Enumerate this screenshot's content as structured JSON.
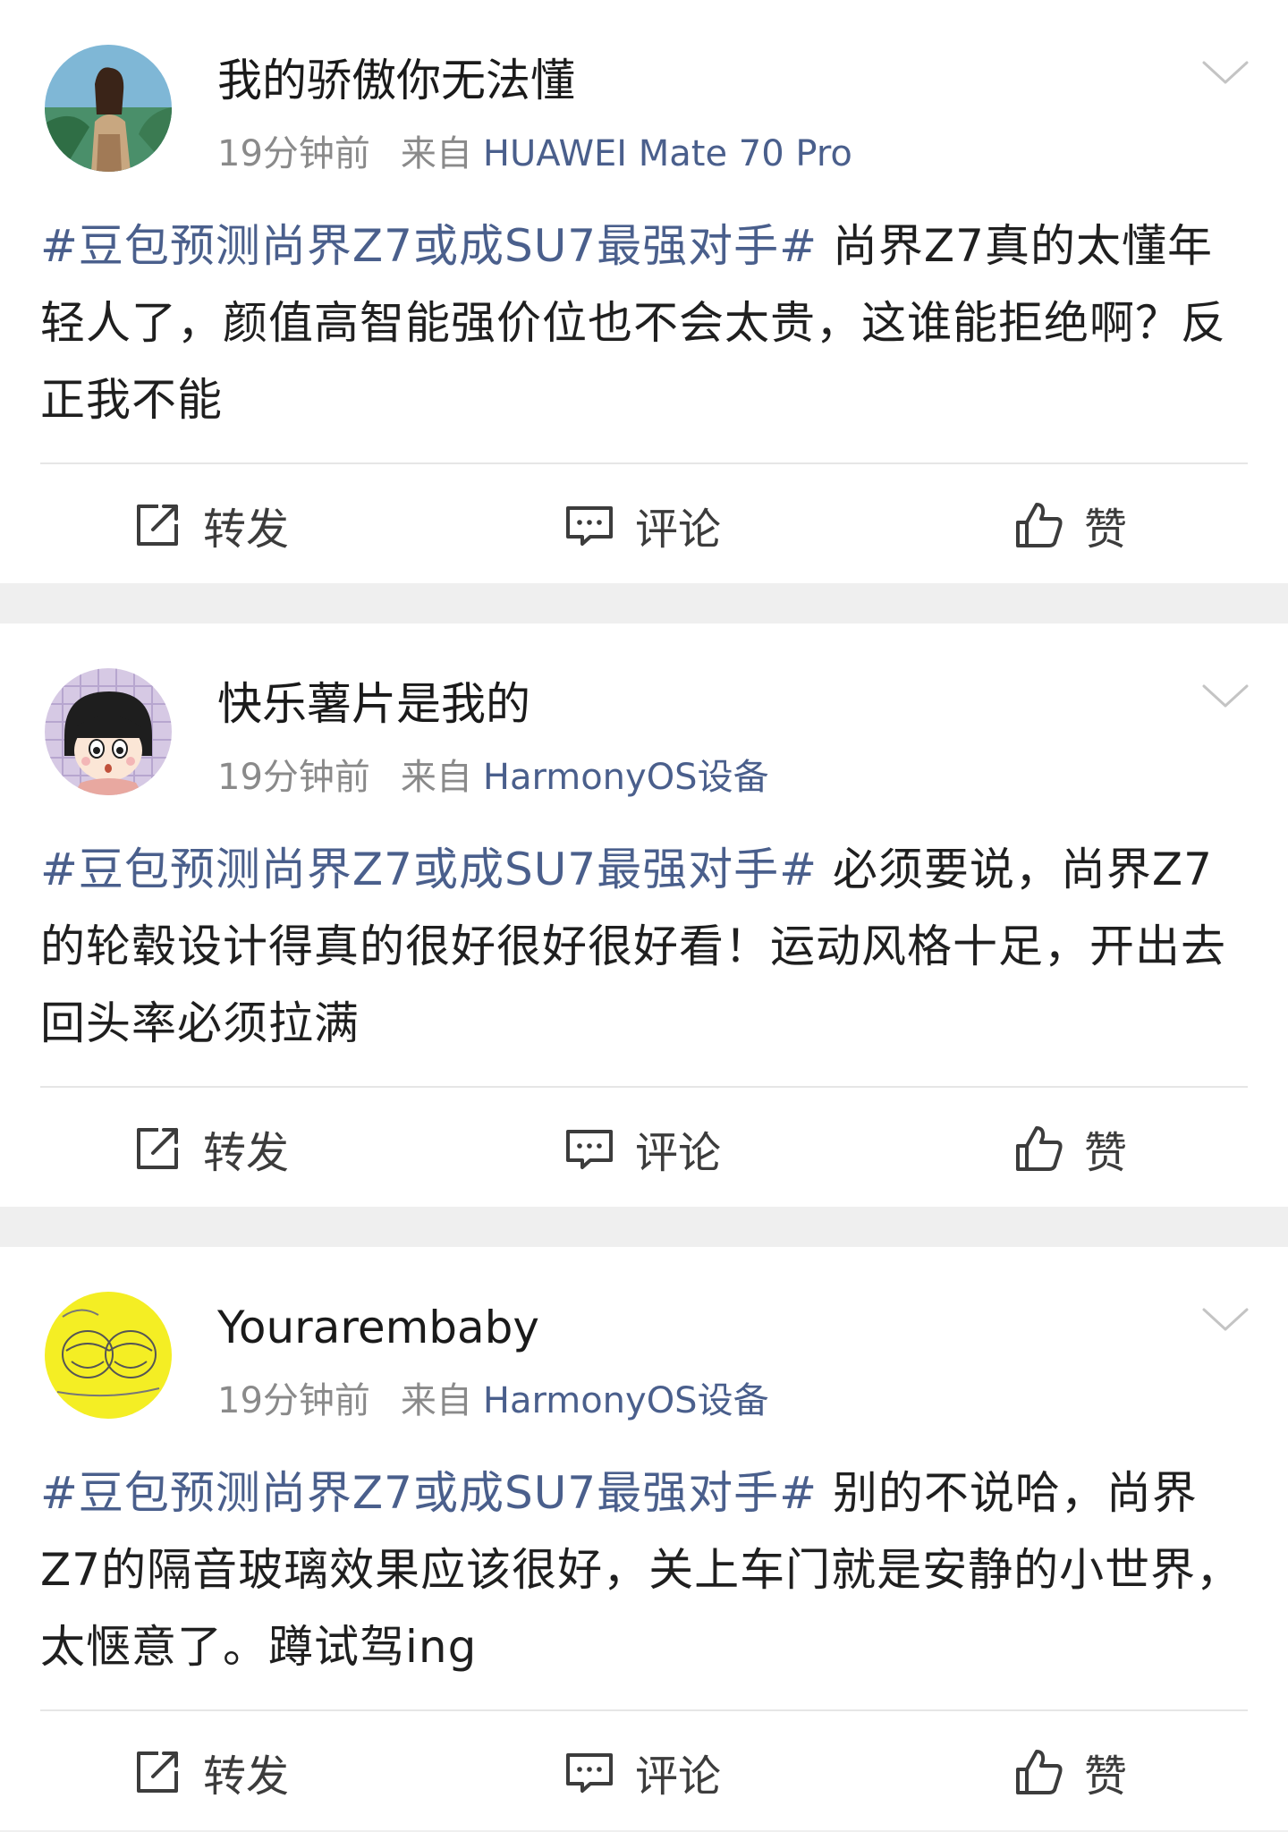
{
  "posts": [
    {
      "username": "我的骄傲你无法懂",
      "time": "19分钟前",
      "from_label": "来自",
      "device": "HUAWEI Mate 70 Pro",
      "hashtag": "#豆包预测尚界Z7或成SU7最强对手#",
      "text": " 尚界Z7真的太懂年轻人了，颜值高智能强价位也不会太贵，这谁能拒绝啊？反正我不能",
      "actions": {
        "repost": "转发",
        "comment": "评论",
        "like": "赞"
      }
    },
    {
      "username": "快乐薯片是我的",
      "time": "19分钟前",
      "from_label": "来自",
      "device": "HarmonyOS设备",
      "hashtag": "#豆包预测尚界Z7或成SU7最强对手#",
      "text": " 必须要说，尚界Z7的轮毂设计得真的很好很好很好看！运动风格十足，开出去回头率必须拉满",
      "actions": {
        "repost": "转发",
        "comment": "评论",
        "like": "赞"
      }
    },
    {
      "username": "Yourarembaby",
      "time": "19分钟前",
      "from_label": "来自",
      "device": "HarmonyOS设备",
      "hashtag": "#豆包预测尚界Z7或成SU7最强对手#",
      "text": " 别的不说哈，尚界Z7的隔音玻璃效果应该很好，关上车门就是安静的小世界，太惬意了。蹲试驾ing",
      "actions": {
        "repost": "转发",
        "comment": "评论",
        "like": "赞"
      }
    }
  ],
  "icons": {
    "repost": "repost-icon",
    "comment": "comment-icon",
    "like": "thumbs-up-icon",
    "more": "chevron-down-icon"
  },
  "colors": {
    "link": "#4a5f8c",
    "meta": "#8a8a8a",
    "text": "#1f1f1f",
    "background": "#efefef"
  }
}
